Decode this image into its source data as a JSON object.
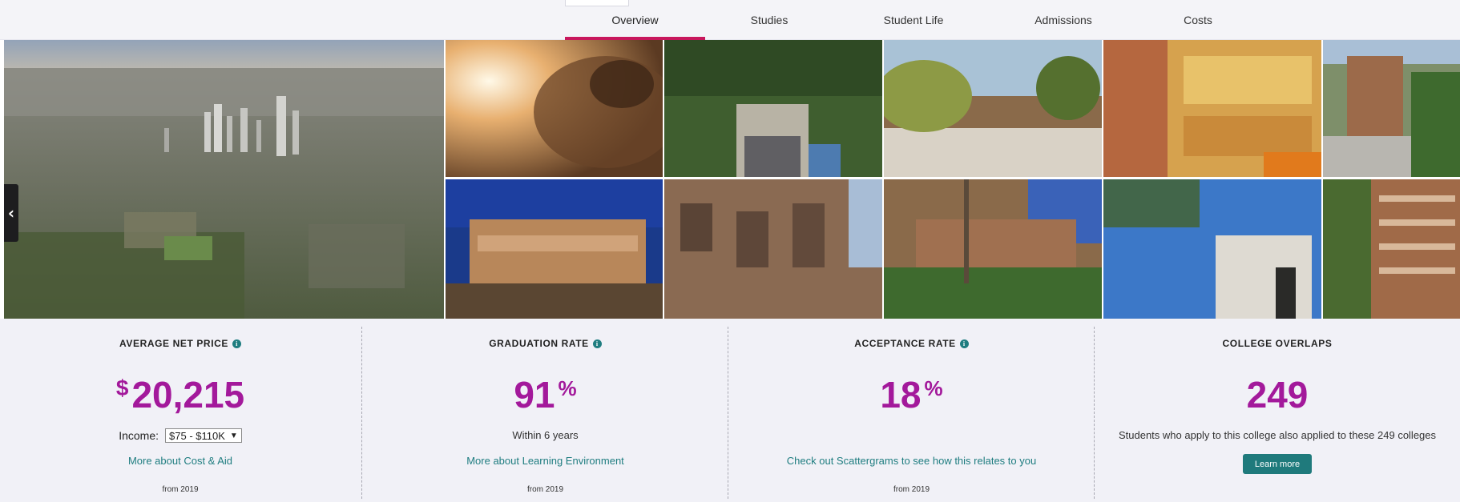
{
  "nav": {
    "tabs": [
      {
        "label": "Overview",
        "active": true
      },
      {
        "label": "Studies",
        "active": false
      },
      {
        "label": "Student Life",
        "active": false
      },
      {
        "label": "Admissions",
        "active": false
      },
      {
        "label": "Costs",
        "active": false
      }
    ],
    "active_color": "#c8175d"
  },
  "gallery": {
    "prev_label": "‹"
  },
  "stats": [
    {
      "title": "AVERAGE NET PRICE",
      "prefix": "$",
      "value": "20,215",
      "suffix": "",
      "income_label": "Income:",
      "income_selected": "$75 - $110K",
      "link": "More about Cost & Aid",
      "from": "from 2019"
    },
    {
      "title": "GRADUATION RATE",
      "prefix": "",
      "value": "91",
      "suffix": "%",
      "sub": "Within 6 years",
      "link": "More about Learning Environment",
      "from": "from 2019"
    },
    {
      "title": "ACCEPTANCE RATE",
      "prefix": "",
      "value": "18",
      "suffix": "%",
      "link": "Check out Scattergrams to see how this relates to you",
      "from": "from 2019"
    },
    {
      "title": "COLLEGE OVERLAPS",
      "prefix": "",
      "value": "249",
      "suffix": "",
      "sub": "Students who apply to this college also applied to these 249 colleges",
      "button": "Learn more"
    }
  ],
  "colors": {
    "accent_value": "#a3199b",
    "link": "#1f7d80",
    "button": "#1f7a7c"
  }
}
